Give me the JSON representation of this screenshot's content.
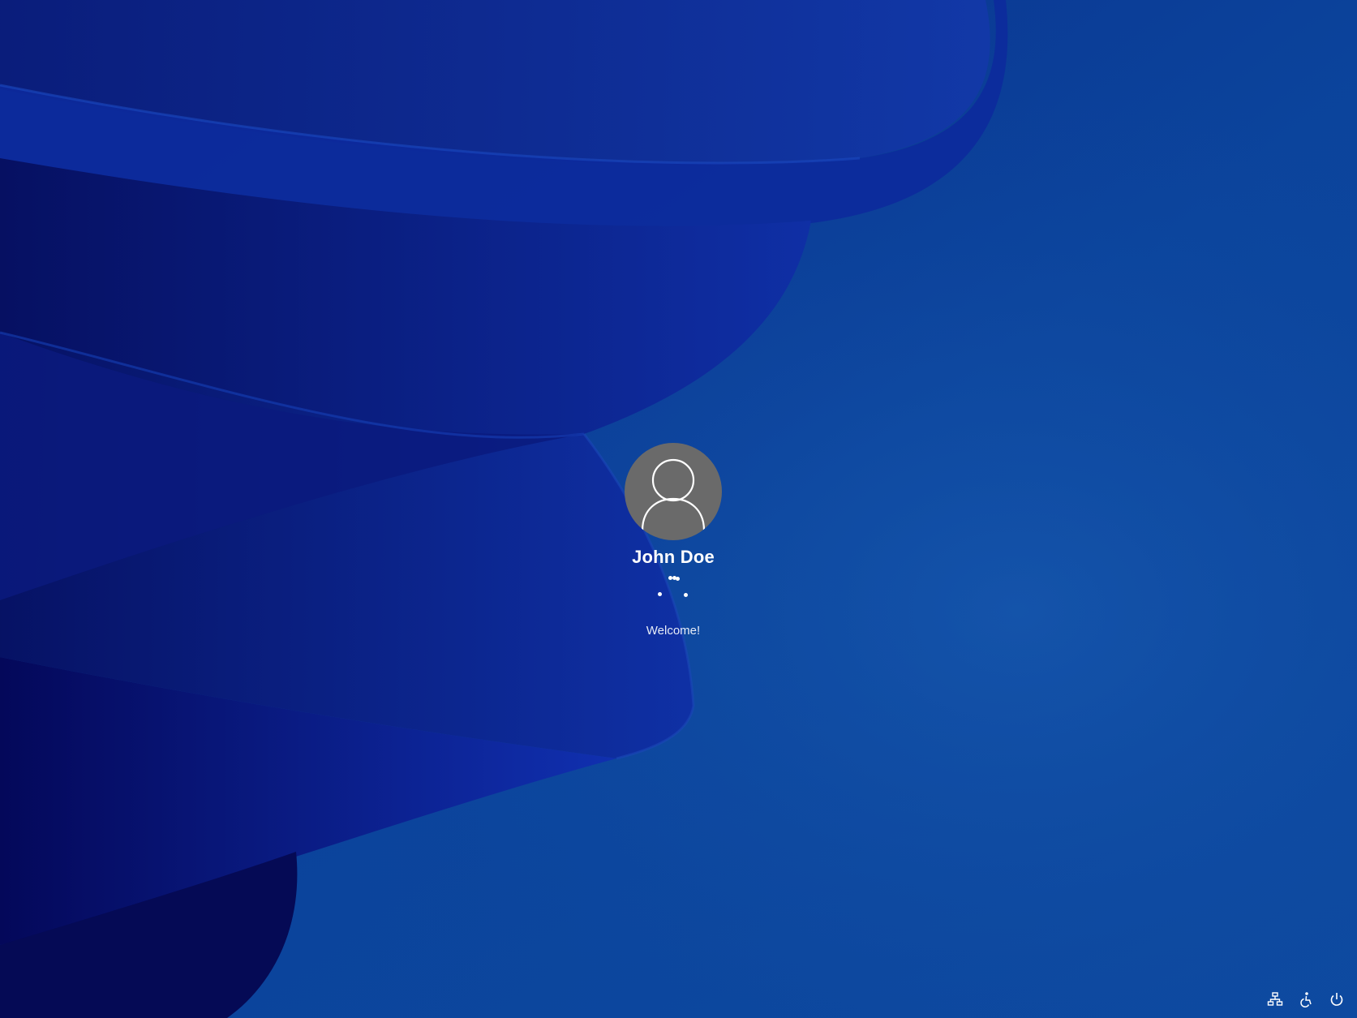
{
  "user": {
    "name": "John Doe",
    "avatar_icon": "default-user-icon"
  },
  "status": {
    "text": "Welcome!",
    "spinner_icon": "loading-spinner-icon"
  },
  "tray": {
    "items": [
      {
        "icon": "network-icon",
        "label": "Network"
      },
      {
        "icon": "accessibility-icon",
        "label": "Accessibility"
      },
      {
        "icon": "power-icon",
        "label": "Power"
      }
    ]
  },
  "colors": {
    "background": "#0b3f98",
    "avatar_bg": "#6a6a6a",
    "text": "#ffffff"
  }
}
